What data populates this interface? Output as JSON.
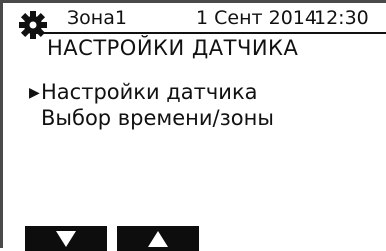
{
  "status_bar": {
    "zone": "Зона1",
    "date": "1 Сент 2014",
    "time": "12:30",
    "icon": "gear-icon"
  },
  "page_title": "НАСТРОЙКИ ДАТЧИКА",
  "menu": {
    "selected_index": 0,
    "selected_marker_icon": "triangle-right-icon",
    "items": [
      {
        "label": "Настройки датчика"
      },
      {
        "label": "Выбор времени/зоны"
      }
    ]
  },
  "softkeys": [
    {
      "icon": "arrow-down-icon"
    },
    {
      "icon": "arrow-up-icon"
    }
  ],
  "colors": {
    "background": "#ffffff",
    "text": "#111111",
    "softkey": "#0d0d0d"
  }
}
